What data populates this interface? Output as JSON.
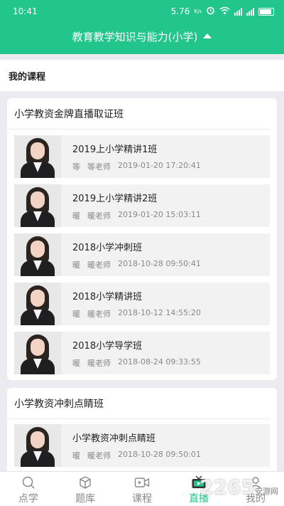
{
  "status": {
    "time": "10:41",
    "speed": "5.76",
    "speed_unit": "K/s"
  },
  "header": {
    "title": "教育教学知识与能力(小学)"
  },
  "my_courses": {
    "label": "我的课程"
  },
  "sections": [
    {
      "title": "小学教资金牌直播取证班",
      "courses": [
        {
          "name": "2019上小学精讲1班",
          "teacher_initial": "等",
          "teacher": "等老师",
          "datetime": "2019-01-20 17:20:41"
        },
        {
          "name": "2019上小学精讲2班",
          "teacher_initial": "暖",
          "teacher": "暖老师",
          "datetime": "2019-01-20 15:03:11"
        },
        {
          "name": "2018小学冲刺班",
          "teacher_initial": "暖",
          "teacher": "暖老师",
          "datetime": "2018-10-28 09:50:41"
        },
        {
          "name": "2018小学精讲班",
          "teacher_initial": "暖",
          "teacher": "暖老师",
          "datetime": "2018-10-12 14:55:20"
        },
        {
          "name": "2018小学导学班",
          "teacher_initial": "暖",
          "teacher": "暖老师",
          "datetime": "2018-08-24 09:33:55"
        }
      ]
    },
    {
      "title": "小学教资冲刺点睛班",
      "courses": [
        {
          "name": "小学教资冲刺点睛班",
          "teacher_initial": "暖",
          "teacher": "暖老师",
          "datetime": "2018-10-28 09:50:01"
        }
      ]
    }
  ],
  "nav": [
    {
      "label": "点学",
      "icon": "search-icon",
      "active": false
    },
    {
      "label": "题库",
      "icon": "cube-icon",
      "active": false
    },
    {
      "label": "课程",
      "icon": "video-icon",
      "active": false
    },
    {
      "label": "直播",
      "icon": "tv-icon",
      "active": true
    },
    {
      "label": "我的",
      "icon": "person-icon",
      "active": false
    }
  ],
  "watermark": {
    "text": "2265",
    "sub": "安游网"
  },
  "colors": {
    "accent": "#22c68c",
    "background": "#ebebf0"
  }
}
